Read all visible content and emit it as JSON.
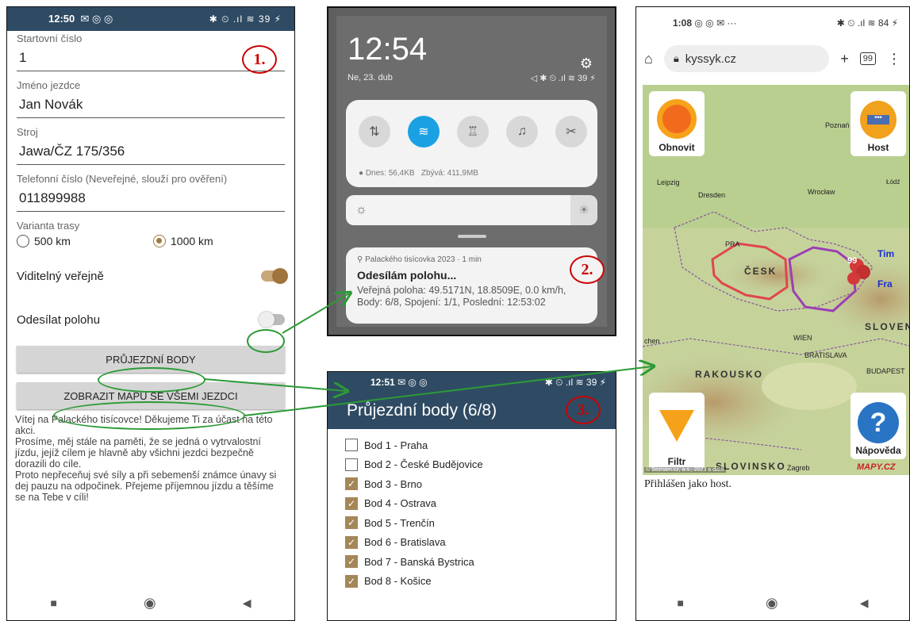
{
  "screen1": {
    "status_time": "12:50",
    "status_icons": "✉ ◎ ◎",
    "status_right": "✱ ⏲ .ıl ≋ 39 ⚡",
    "badge": "1.",
    "fields": [
      {
        "label": "Startovní číslo",
        "value": "1"
      },
      {
        "label": "Jméno jezdce",
        "value": "Jan Novák"
      },
      {
        "label": "Stroj",
        "value": "Jawa/ČZ 175/356"
      },
      {
        "label": "Telefonní číslo (Neveřejné, slouží pro ověření)",
        "value": "011899988"
      }
    ],
    "route_label": "Varianta trasy",
    "route_options": [
      "500 km",
      "1000 km"
    ],
    "route_selected": "1000 km",
    "public_label": "Viditelný veřejně",
    "public_on": true,
    "send_label": "Odesílat polohu",
    "send_on": false,
    "btn_waypoints": "PRŮJEZDNÍ BODY",
    "btn_map": "ZOBRAZIT MAPU SE VŠEMI JEZDCI",
    "info_text": "Vítej na Palackého tisícovce! Děkujeme Ti za účast na této akci.\nProsíme, měj stále na paměti, že se jedná o vytrvalostní jízdu, jejíž cílem je hlavně aby všichni jezdci bezpečně dorazili do cíle.\nProto nepřeceňuj své síly a při sebemenší známce únavy si dej pauzu na odpočinek. Přejeme příjemnou jízdu a těšíme se na Tebe v cíli!"
  },
  "screen2": {
    "time": "12:54",
    "date": "Ne, 23. dub",
    "status_right": "◁ ✱ ⏲ .ıl ≋ 39 ⚡",
    "data_today": "Dnes: 56,4KB",
    "data_left": "Zbývá: 411,9MB",
    "badge": "2.",
    "notif_app": "Palackého tisícovka 2023 · 1 min",
    "notif_title": "Odesílám polohu...",
    "notif_body": "Veřejná poloha: 49.5171N, 18.8509E, 0.0 km/h, Body: 6/8, Spojení: 1/1, Poslední: 12:53:02"
  },
  "screen3": {
    "status_time": "12:51",
    "status_icons": "✉ ◎ ◎",
    "status_right": "✱ ⏲ .ıl ≋ 39 ⚡",
    "title": "Průjezdní body (6/8)",
    "badge": "3.",
    "points": [
      {
        "label": "Bod 1 - Praha",
        "checked": false
      },
      {
        "label": "Bod 2 - České Budějovice",
        "checked": false
      },
      {
        "label": "Bod 3 - Brno",
        "checked": true
      },
      {
        "label": "Bod 4 - Ostrava",
        "checked": true
      },
      {
        "label": "Bod 5 - Trenčín",
        "checked": true
      },
      {
        "label": "Bod 6 - Bratislava",
        "checked": true
      },
      {
        "label": "Bod 7 - Banská Bystrica",
        "checked": true
      },
      {
        "label": "Bod 8 - Košice",
        "checked": true
      }
    ]
  },
  "screen4": {
    "status_time": "1:08",
    "status_icons": "◎ ◎ ✉ ···",
    "status_right": "✱ ⏲ .ıl ≋ 84 ⚡",
    "url": "kyssyk.cz",
    "tabs_count": "99",
    "btn_refresh": "Obnovit",
    "btn_host": "Host",
    "btn_filter": "Filtr",
    "btn_help": "Nápověda",
    "map_labels": {
      "poznan": "Poznań",
      "leipzig": "Leipzig",
      "dresden": "Dresden",
      "wroclaw": "Wrocław",
      "praha": "PRA",
      "cesko": "ČESK",
      "wien": "WIEN",
      "bratislava": "BRATISLAVA",
      "rakousko": "RAKOUSKO",
      "slovinsko": "SLOVINSKO",
      "zagreb": "Zagreb",
      "budapest": "BUDAPEST",
      "sloven": "SLOVEN",
      "lodz": "Łódź",
      "chen": "chen",
      "rider1": "Tim",
      "rider2": "Fra",
      "marker": "99"
    },
    "mapy_logo": "MAPY.CZ",
    "copyright": "© Seznam.cz, a.s., 2023 a další",
    "login_text": "Přihlášen jako host."
  },
  "colors": {
    "header": "#2f4b63",
    "accent": "#a58757",
    "annot_green": "#2c9a36",
    "annot_red": "#cc0000"
  }
}
